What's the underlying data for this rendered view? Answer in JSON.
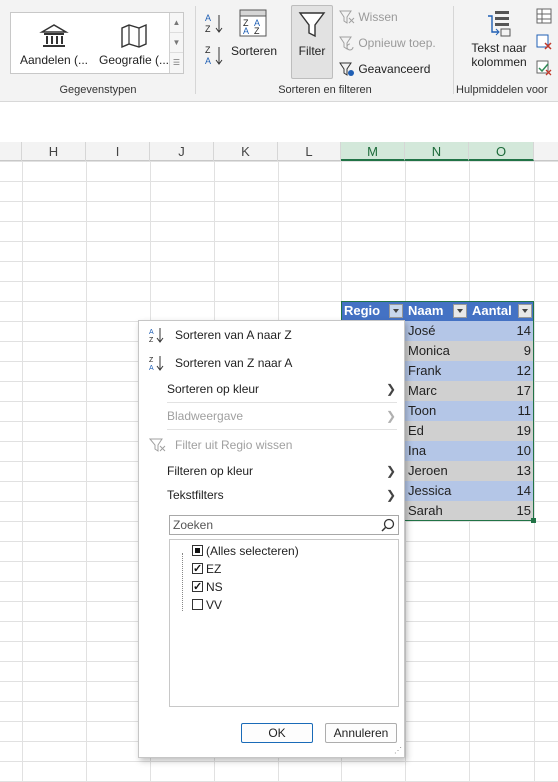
{
  "ribbon": {
    "datatypes": {
      "stocks_label": "Aandelen (...",
      "geography_label": "Geografie (...",
      "group_label": "Gegevenstypen"
    },
    "sort_filter": {
      "sort_label": "Sorteren",
      "filter_label": "Filter",
      "clear_label": "Wissen",
      "reapply_label": "Opnieuw toep.",
      "advanced_label": "Geavanceerd",
      "group_label": "Sorteren en filteren"
    },
    "tools": {
      "text_to_columns_line1": "Tekst naar",
      "text_to_columns_line2": "kolommen",
      "group_label": "Hulpmiddelen voor"
    }
  },
  "columns": [
    "H",
    "I",
    "J",
    "K",
    "L",
    "M",
    "N",
    "O"
  ],
  "table": {
    "headers": [
      "Regio",
      "Naam",
      "Aantal"
    ],
    "rows": [
      {
        "naam": "José",
        "aantal": "14"
      },
      {
        "naam": "Monica",
        "aantal": "9"
      },
      {
        "naam": "Frank",
        "aantal": "12"
      },
      {
        "naam": "Marc",
        "aantal": "17"
      },
      {
        "naam": "Toon",
        "aantal": "11"
      },
      {
        "naam": "Ed",
        "aantal": "19"
      },
      {
        "naam": "Ina",
        "aantal": "10"
      },
      {
        "naam": "Jeroen",
        "aantal": "13"
      },
      {
        "naam": "Jessica",
        "aantal": "14"
      },
      {
        "naam": "Sarah",
        "aantal": "15"
      }
    ]
  },
  "menu": {
    "sort_az": "Sorteren van A naar Z",
    "sort_za": "Sorteren van Z naar A",
    "sort_by_color": "Sorteren op kleur",
    "sheet_view": "Bladweergave",
    "clear_filter": "Filter uit Regio wissen",
    "filter_by_color": "Filteren op kleur",
    "text_filters": "Tekstfilters",
    "search_placeholder": "Zoeken",
    "list": [
      {
        "label": "(Alles selecteren)",
        "state": "mixed"
      },
      {
        "label": "EZ",
        "state": "checked"
      },
      {
        "label": "NS",
        "state": "checked"
      },
      {
        "label": "VV",
        "state": "unchecked"
      }
    ],
    "ok_label": "OK",
    "cancel_label": "Annuleren"
  }
}
